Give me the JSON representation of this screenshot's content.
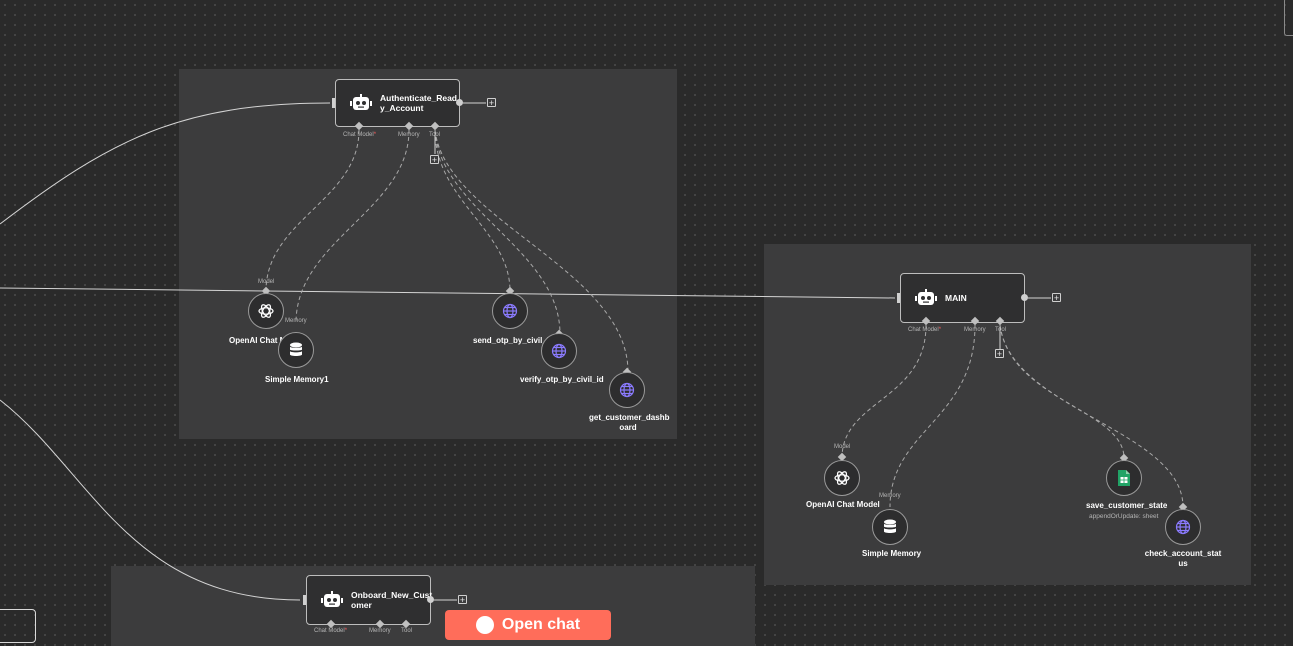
{
  "canvas": {
    "nodes": {
      "authenticate": {
        "title": "Authenticate_Read\ny_Account",
        "ports": {
          "chat_model": "Chat Model",
          "memory": "Memory",
          "tool": "Tool"
        }
      },
      "main": {
        "title": "MAIN",
        "ports": {
          "chat_model": "Chat Model",
          "memory": "Memory",
          "tool": "Tool"
        }
      },
      "onboard": {
        "title": "Onboard_New_Cust\nomer",
        "ports": {
          "chat_model": "Chat Model",
          "memory": "Memory",
          "tool": "Tool"
        }
      }
    },
    "sub_nodes": {
      "openai_1": {
        "label": "OpenAI Chat M",
        "port": "Model",
        "icon": "openai-icon"
      },
      "memory_1": {
        "label": "Simple Memory1",
        "port": "Memory",
        "icon": "database-icon"
      },
      "send_otp": {
        "label": "send_otp_by_civil_i",
        "icon": "globe-icon"
      },
      "verify_otp": {
        "label": "verify_otp_by_civil_id",
        "icon": "globe-icon"
      },
      "get_dashboard": {
        "label": "get_customer_dashb\noard",
        "icon": "globe-icon"
      },
      "openai_2": {
        "label": "OpenAI Chat Model",
        "port": "Model",
        "icon": "openai-icon"
      },
      "memory_2": {
        "label": "Simple Memory",
        "port": "Memory",
        "icon": "database-icon"
      },
      "save_state": {
        "label": "save_customer_state",
        "sublabel": "appendOrUpdate: sheet",
        "icon": "sheets-icon"
      },
      "check_status": {
        "label": "check_account_stat\nus",
        "icon": "globe-icon"
      }
    },
    "open_chat": {
      "label": "Open chat"
    },
    "colors": {
      "canvas": "#2a2a2a",
      "group": "#3c3c3d",
      "accent": "#ff6d5a",
      "tool_icon": "#8b7bff",
      "sheets": "#21a366"
    }
  }
}
